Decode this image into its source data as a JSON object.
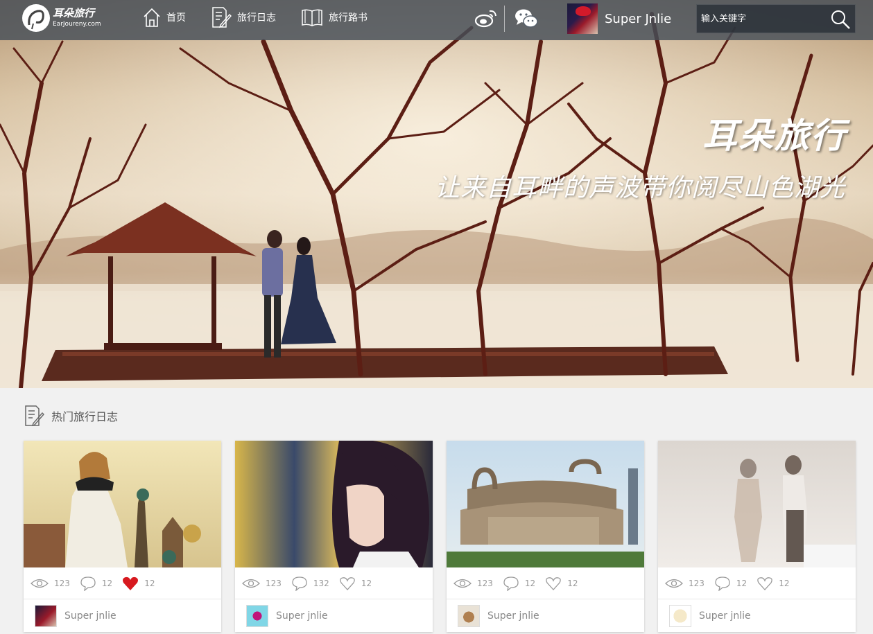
{
  "nav": {
    "logo_text": "耳朵旅行",
    "logo_domain": "EarJoureny.com",
    "items": [
      {
        "label": "首页",
        "icon": "home-icon"
      },
      {
        "label": "旅行日志",
        "icon": "journal-icon"
      },
      {
        "label": "旅行路书",
        "icon": "book-icon"
      }
    ],
    "social": [
      "weibo-icon",
      "wechat-icon"
    ],
    "user_name": "Super Jnlie",
    "search_placeholder": "输入关键字"
  },
  "hero": {
    "title": "耳朵旅行",
    "subtitle": "让来自耳畔的声波带你阅尽山色湖光"
  },
  "section": {
    "title": "热门旅行日志"
  },
  "cards": [
    {
      "views": "123",
      "comments": "12",
      "likes": "12",
      "liked": true,
      "author": "Super jnlie"
    },
    {
      "views": "123",
      "comments": "132",
      "likes": "12",
      "liked": false,
      "author": "Super jnlie"
    },
    {
      "views": "123",
      "comments": "12",
      "likes": "12",
      "liked": false,
      "author": "Super jnlie"
    },
    {
      "views": "123",
      "comments": "12",
      "likes": "12",
      "liked": false,
      "author": "Super jnlie"
    }
  ],
  "colors": {
    "nav_bg": "#464e58",
    "like_active": "#d7191f",
    "text_muted": "#999999",
    "page_bg": "#f1f1f1"
  }
}
